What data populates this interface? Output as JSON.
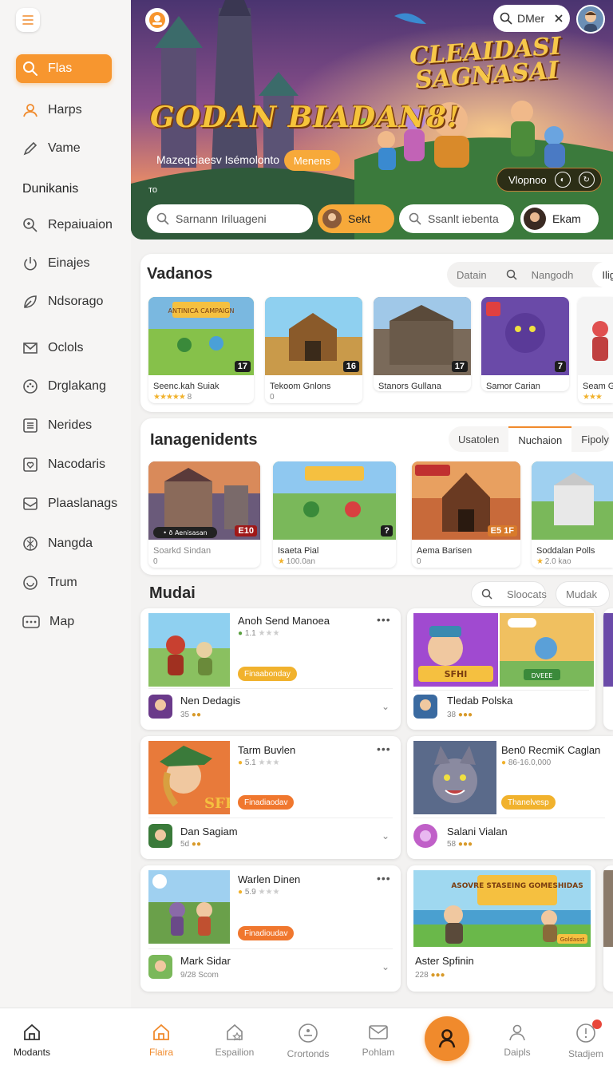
{
  "sidebar": {
    "items_top": [
      {
        "label": "Flas",
        "icon": "search-icon",
        "active": true
      },
      {
        "label": "Harps",
        "icon": "user-icon"
      },
      {
        "label": "Vame",
        "icon": "pen-icon"
      }
    ],
    "section_label": "Dunikanis",
    "items": [
      {
        "label": "Repaiuaion",
        "icon": "magnify-plus-icon"
      },
      {
        "label": "Einajes",
        "icon": "power-icon"
      },
      {
        "label": "Ndsorago",
        "icon": "leaf-icon"
      },
      {
        "label": "Oclols",
        "icon": "mail-icon"
      },
      {
        "label": "Drglakang",
        "icon": "gamepad-icon"
      },
      {
        "label": "Nerides",
        "icon": "list-icon"
      },
      {
        "label": "Nacodaris",
        "icon": "heart-box-icon"
      },
      {
        "label": "Plaaslanags",
        "icon": "inbox-icon"
      },
      {
        "label": "Nangda",
        "icon": "grid-circle-icon"
      },
      {
        "label": "Trum",
        "icon": "circle-icon"
      },
      {
        "label": "Map",
        "icon": "more-box-icon"
      }
    ]
  },
  "hero": {
    "search_text": "DMer",
    "title_main": "GODAN BIADAN8!",
    "title_secondary_line1": "CLEAIDASI",
    "title_secondary_line2": "SAGNASAI",
    "subtitle": "Mazeqciaesv Isémolonto",
    "cta_label": "Menens",
    "small_text": "то",
    "pill_label": "Vlopnoo",
    "search1_placeholder": "Sarnann Iriluageni",
    "button_label": "Sekt",
    "search2_placeholder": "Ssanlt iebenta",
    "user_label": "Ekam",
    "accent": "#f7962f"
  },
  "sec1": {
    "title": "Vadanos",
    "pills": [
      "Datain",
      "Nangodh",
      "Iligah"
    ],
    "tiles": [
      {
        "caption": "Seenc.kah Suiak",
        "sub": "8",
        "badge": "17",
        "stars": "★★★★★"
      },
      {
        "caption": "Tekoom Gnlons",
        "sub": "0",
        "badge": "16"
      },
      {
        "caption": "Stanors Gullana",
        "sub": "",
        "badge": "17"
      },
      {
        "caption": "Samor Carian",
        "sub": "",
        "badge": "7"
      },
      {
        "caption": "Seam G",
        "sub": "",
        "stars": "★★★"
      }
    ]
  },
  "sec2": {
    "title": "Ianagenidents",
    "pills": [
      "Usatolen",
      "Nuchaion",
      "Fipoly"
    ],
    "tiles": [
      {
        "caption": "Soarkd Sindan",
        "sub": "0",
        "badge": "E10",
        "overlay": "• ð Aenisasan"
      },
      {
        "caption": "Isaeta Pial",
        "sub": "100.0an",
        "badge": "?",
        "stars": "★"
      },
      {
        "caption": "Aema Barisen",
        "sub": "0",
        "badge": "E5 1F"
      },
      {
        "caption": "Soddalan Polls",
        "sub": "2.0 kao",
        "stars": "★"
      }
    ]
  },
  "sec3": {
    "title": "Mudai",
    "search_label": "Sloocats",
    "filter_label": "Mudak",
    "cards": [
      {
        "title": "Anoh Send Manoea",
        "rating": "1.1",
        "tag": "Finaabonday",
        "tag_color": "#f1b22d",
        "name": "Nen Dedagis",
        "meta": "35"
      },
      {
        "title": "",
        "tag": "",
        "name": "Tledab Polska",
        "meta": "38"
      },
      {
        "title": "Tarm Buvlen",
        "rating": "5.1",
        "tag": "Finadiaodav",
        "tag_color": "#f0772e",
        "name": "Dan Sagiam",
        "meta": "5d"
      },
      {
        "title": "Ben0 RecmiK Caglan",
        "rating": "86-16.0,000",
        "tag": "Thanelvesp",
        "tag_color": "#f1b22d",
        "name": "Salani Vialan",
        "meta": "58"
      },
      {
        "title": "Warlen Dinen",
        "rating": "5.9",
        "tag": "Finadioudav",
        "tag_color": "#f0772e",
        "name": "Mark Sidar",
        "meta": "9/28 Scom"
      },
      {
        "title": "",
        "tag": "",
        "name": "Aster Spfinin",
        "meta": "228"
      }
    ]
  },
  "bottom_nav": [
    {
      "label": "Modants",
      "icon": "home-icon"
    },
    {
      "label": "Flaira",
      "icon": "home-icon"
    },
    {
      "label": "Espailion",
      "icon": "house-star-icon"
    },
    {
      "label": "Crortonds",
      "icon": "smile-circle-icon"
    },
    {
      "label": "Pohlam",
      "icon": "mail-icon"
    },
    {
      "label": "Daipls",
      "icon": "user-icon"
    },
    {
      "label": "Stadjem",
      "icon": "bell-circle-icon"
    }
  ],
  "art_text": {
    "thumb_1": "ANTINICA CAMPAIGN",
    "thumb_2": "SFHI",
    "thumb_3": "DVEEE",
    "thumb_4": "SFHI",
    "thumb_5": "ASOVRE STASEING GOMESHIDAS",
    "thumb_6": "Goldasst"
  }
}
